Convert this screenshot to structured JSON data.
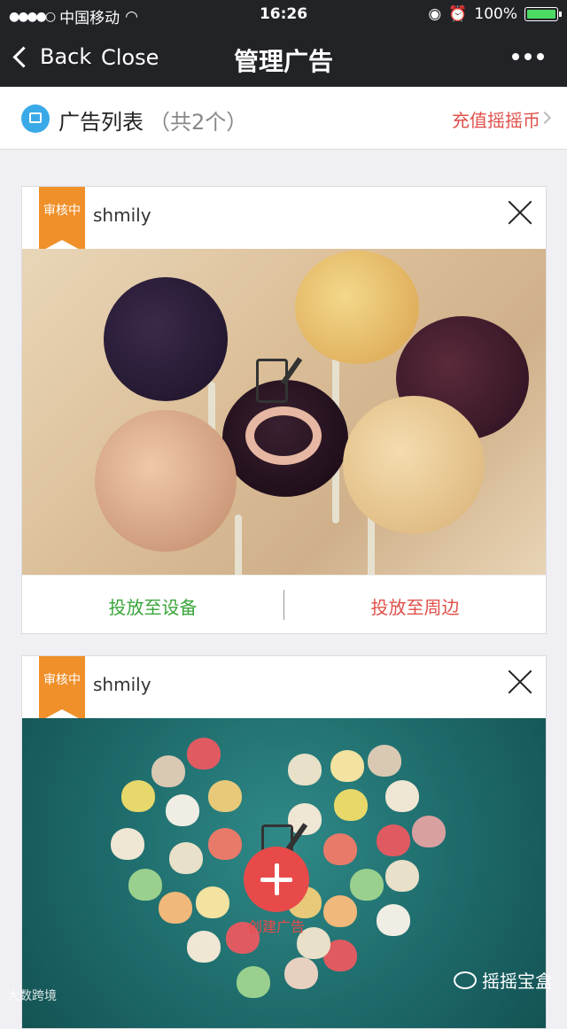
{
  "status": {
    "carrier": "中国移动",
    "time": "16:26",
    "battery": "100%"
  },
  "nav": {
    "back": "Back",
    "close": "Close",
    "title": "管理广告"
  },
  "listbar": {
    "title": "广告列表",
    "count": "（共2个）",
    "recharge": "充值摇摇币"
  },
  "cards": [
    {
      "badge": "审核中",
      "name": "shmily",
      "action_device": "投放至设备",
      "action_nearby": "投放至周边"
    },
    {
      "badge": "审核中",
      "name": "shmily",
      "create_label": "创建广告"
    }
  ],
  "watermark": {
    "left": "大数跨境",
    "right": "摇摇宝盒"
  },
  "colors": {
    "nav_bg": "#222327",
    "accent_red": "#e0504a",
    "accent_green": "#3aa53a",
    "badge_orange": "#f0902a"
  }
}
